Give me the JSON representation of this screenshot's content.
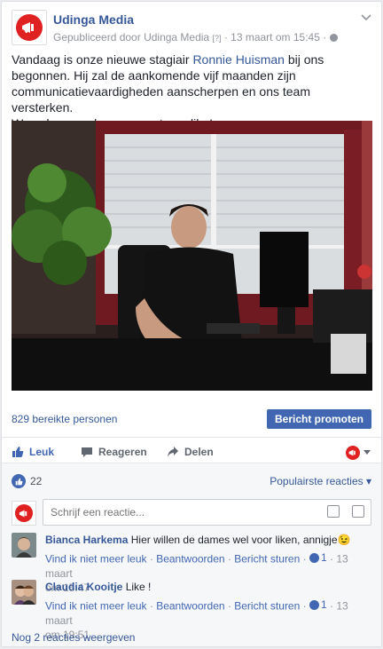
{
  "post": {
    "page_name": "Udinga Media",
    "published_by": "Gepubliceerd door Udinga Media",
    "badge": "[?]",
    "date": "13 maart om 15:45",
    "separator": "·",
    "text_before_mention": "Vandaag is onze nieuwe stagiair ",
    "mention": "Ronnie Huisman",
    "text_after_mention": " bij ons begonnen. Hij zal de aankomende vijf maanden zijn communicatievaardigheden aanscherpen en ons team versterken.",
    "text_line2": "Wens hem veel succes met een like!"
  },
  "reach": {
    "label": "829 bereikte personen",
    "promote_button": "Bericht promoten"
  },
  "actions": {
    "like": "Leuk",
    "comment": "Reageren",
    "share": "Delen"
  },
  "reactions": {
    "count": "22",
    "sort_label": "Populairste reacties",
    "sort_arrow": "▾"
  },
  "composer": {
    "placeholder": "Schrijf een reactie..."
  },
  "comments": [
    {
      "author": "Bianca Harkema",
      "text": "Hier willen de dames wel voor liken, annigje",
      "emoji": "😉",
      "unlike": "Vind ik niet meer leuk",
      "reply": "Beantwoorden",
      "message": "Bericht sturen",
      "likes": "1",
      "date_line1": "13 maart",
      "date_line2": "om 15:47"
    },
    {
      "author": "Claudia Kooitje",
      "text": "Like !",
      "unlike": "Vind ik niet meer leuk",
      "reply": "Beantwoorden",
      "message": "Bericht sturen",
      "likes": "1",
      "date_line1": "13 maart",
      "date_line2": "om 19:51"
    }
  ],
  "more_comments": "Nog 2 reacties weergeven",
  "colors": {
    "accent": "#4267b2",
    "link": "#365899",
    "brand_red": "#e02121"
  }
}
